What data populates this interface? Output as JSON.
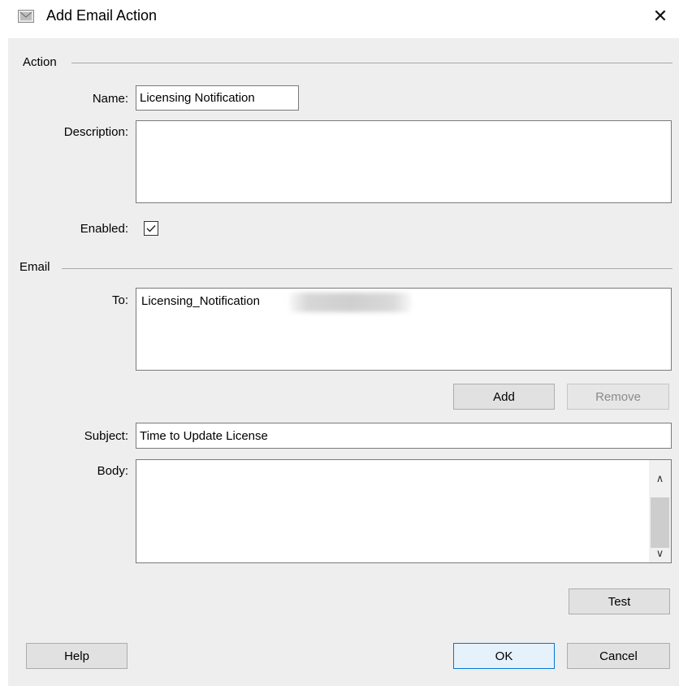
{
  "window": {
    "title": "Add Email Action",
    "close_glyph": "✕"
  },
  "action_section": {
    "title": "Action",
    "name_label": "Name:",
    "name_value": "Licensing Notification",
    "description_label": "Description:",
    "description_value": "",
    "enabled_label": "Enabled:",
    "enabled_checked": true
  },
  "email_section": {
    "title": "Email",
    "to_label": "To:",
    "to_recipients": [
      "Licensing_Notification"
    ],
    "add_label": "Add",
    "remove_label": "Remove",
    "subject_label": "Subject:",
    "subject_value": "Time to Update License",
    "body_label": "Body:",
    "body_value": "",
    "scroll_up_glyph": "∧",
    "scroll_down_glyph": "∨",
    "test_label": "Test"
  },
  "footer": {
    "help_label": "Help",
    "ok_label": "OK",
    "cancel_label": "Cancel"
  },
  "icons": {
    "title_icon": "email-action-icon",
    "close_icon": "close-icon",
    "check_icon": "checkmark-icon"
  },
  "colors": {
    "dialog_bg": "#eeeeee",
    "default_button_border": "#0078d7",
    "default_button_bg": "#e5f1fb"
  }
}
